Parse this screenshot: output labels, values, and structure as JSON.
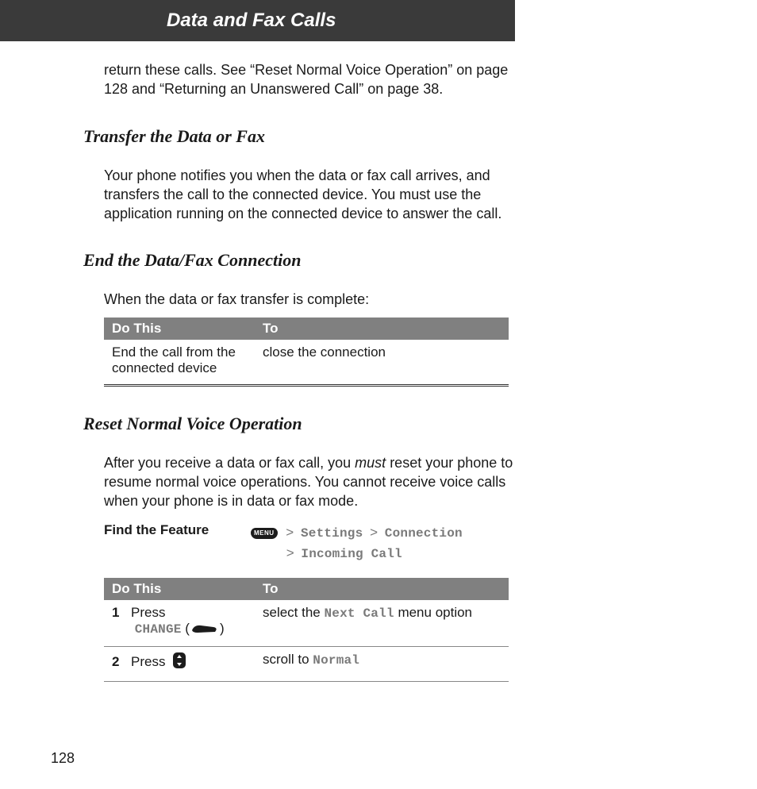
{
  "header": {
    "title": "Data and Fax Calls",
    "band_color": "#3a3a3a"
  },
  "intro": {
    "line": "return these calls. See “Reset Normal Voice Operation” on page 128 and “Returning an Unanswered Call” on page 38."
  },
  "sections": {
    "transfer": {
      "heading": "Transfer the Data or Fax",
      "text": "Your phone notifies you when the data or fax call arrives, and transfers the call to the connected device. You must use the application running on the connected device to answer the call."
    },
    "end": {
      "heading": "End the Data/Fax Connection",
      "text": "When the data or fax transfer is complete:",
      "table": {
        "headers": {
          "doThis": "Do This",
          "to": "To"
        },
        "rows": [
          {
            "doThis": "End the call from the connected device",
            "to": "close the connection"
          }
        ]
      }
    },
    "reset": {
      "heading": "Reset Normal Voice Operation",
      "text_pre": "After you receive a data or fax call, you ",
      "text_em": "must",
      "text_post": " reset your phone to resume normal voice operations. You cannot receive voice calls when your phone is in data or fax mode.",
      "findFeature": {
        "label": "Find the Feature",
        "menuWord": "MENU",
        "gt": ">",
        "path1_a": "Settings",
        "path1_b": "Connection",
        "path2_a": "Incoming Call"
      },
      "table": {
        "headers": {
          "doThis": "Do This",
          "to": "To"
        },
        "rows": [
          {
            "num": "1",
            "pressWord": "Press",
            "changeWord": "CHANGE",
            "to_pre": "select the ",
            "to_mono": "Next Call",
            "to_post": " menu option"
          },
          {
            "num": "2",
            "pressWord": "Press",
            "to_pre": "scroll to ",
            "to_mono": "Normal",
            "to_post": ""
          }
        ]
      }
    }
  },
  "pageNumber": "128"
}
